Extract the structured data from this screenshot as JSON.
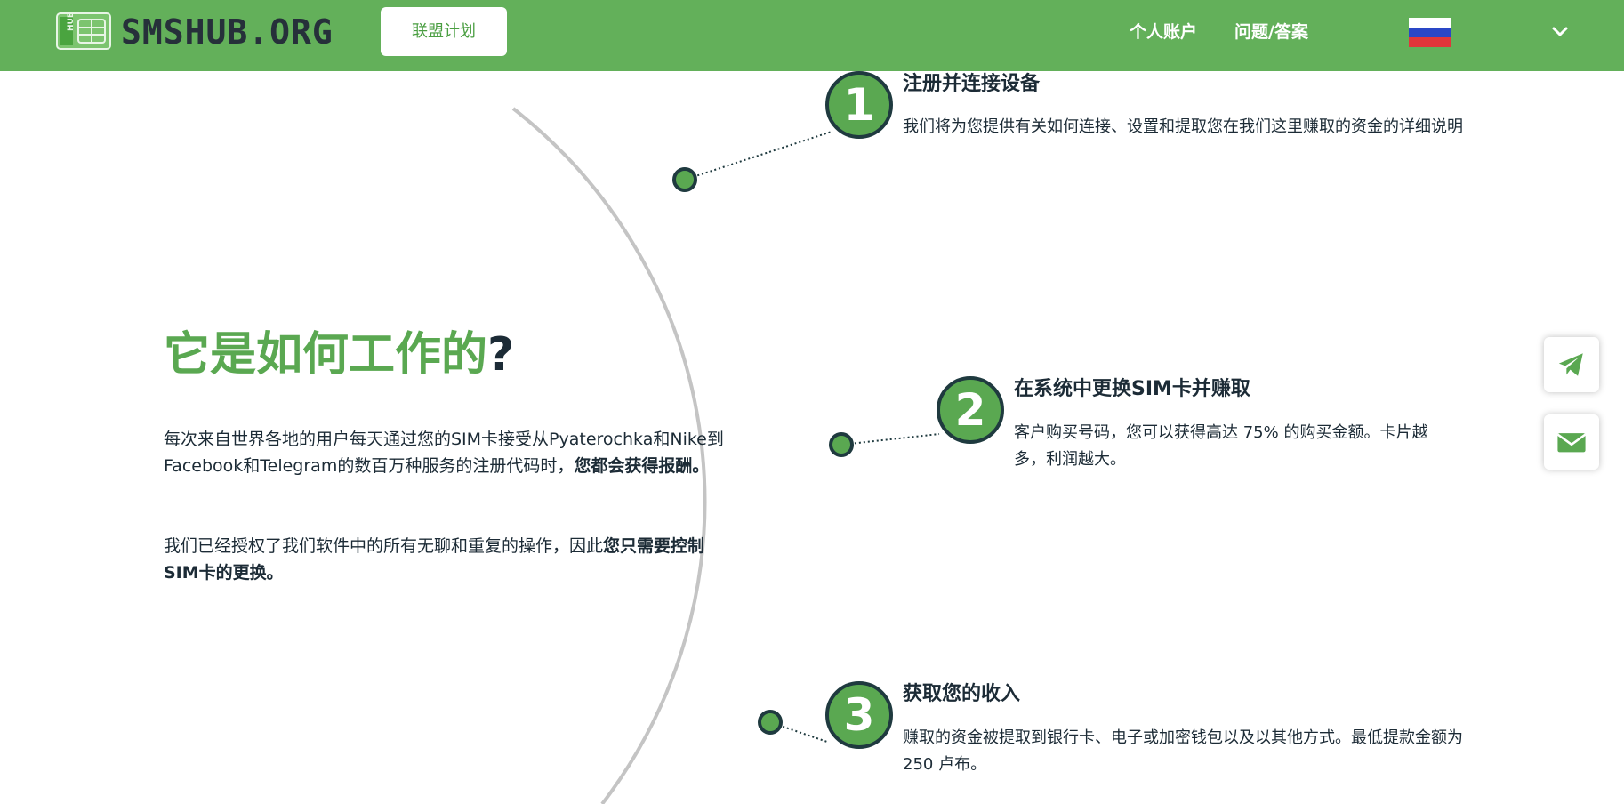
{
  "header": {
    "logo_text": "SMSHUB.ORG",
    "affiliate_label": "联盟计划",
    "nav": [
      "个人账户",
      "问题/答案"
    ],
    "language_flag": "russia-flag-icon",
    "language_menu_icon": "chevron-down-icon"
  },
  "colors": {
    "header_bg": "#63b05a",
    "accent_green": "#5aa851",
    "dark_text": "#1c2b36",
    "arc_gray": "#c4c4c4"
  },
  "hero": {
    "title_green": "它是如何工作的",
    "title_mark": "?",
    "para1_text": "每次来自世界各地的用户每天通过您的SIM卡接受从Pyaterochka和Nike到Facebook和Telegram的数百万种服务的注册代码时，",
    "para1_bold": "您都会获得报酬。",
    "para2_text": "我们已经授权了我们软件中的所有无聊和重复的操作，因此",
    "para2_bold": "您只需要控制SIM卡的更换。"
  },
  "steps": [
    {
      "number": "1",
      "title": "注册并连接设备",
      "desc": "我们将为您提供有关如何连接、设置和提取您在我们这里赚取的资金的详细说明"
    },
    {
      "number": "2",
      "title": "在系统中更换SIM卡并赚取",
      "desc": "客户购买号码，您可以获得高达 75% 的购买金额。卡片越多，利润越大。"
    },
    {
      "number": "3",
      "title": "获取您的收入",
      "desc": "赚取的资金被提取到银行卡、电子或加密钱包以及以其他方式。最低提款金额为 250 卢布。"
    }
  ],
  "floating": {
    "telegram_icon": "telegram-icon",
    "mail_icon": "mail-icon"
  }
}
